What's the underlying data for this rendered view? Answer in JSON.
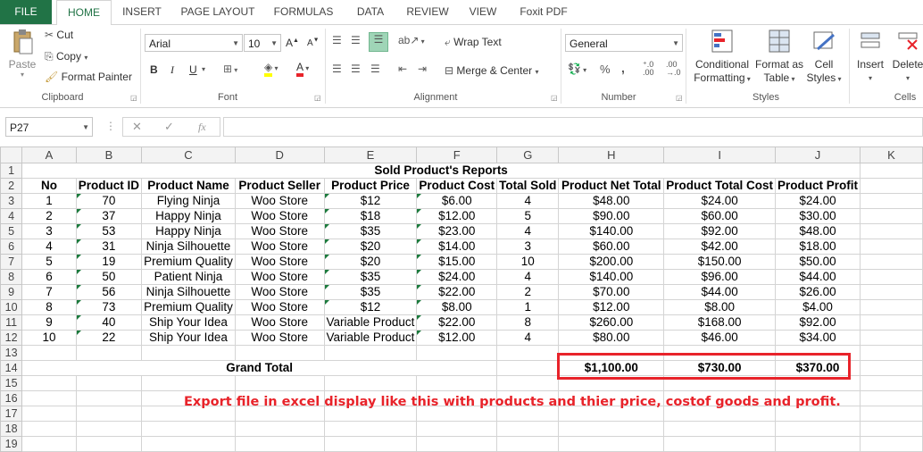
{
  "ribbon_tabs": [
    "FILE",
    "HOME",
    "INSERT",
    "PAGE LAYOUT",
    "FORMULAS",
    "DATA",
    "REVIEW",
    "VIEW",
    "Foxit PDF"
  ],
  "active_tab": "HOME",
  "colors": {
    "excel_green": "#217346",
    "annotation_red": "#e8232a",
    "header_gray": "#f3f3f3"
  },
  "clipboard": {
    "paste": "Paste",
    "cut": "Cut",
    "copy": "Copy",
    "format_painter": "Format Painter",
    "label": "Clipboard"
  },
  "font": {
    "name": "Arial",
    "size": "10",
    "label": "Font",
    "bold": "B",
    "italic": "I",
    "underline": "U"
  },
  "alignment": {
    "wrap_text": "Wrap Text",
    "merge_center": "Merge & Center",
    "label": "Alignment"
  },
  "number": {
    "format": "General",
    "percent": "%",
    "comma": ",",
    "label": "Number"
  },
  "styles": {
    "conditional": "Conditional",
    "conditional2": "Formatting",
    "format_as": "Format as",
    "format_as2": "Table",
    "cell": "Cell",
    "cell2": "Styles",
    "label": "Styles"
  },
  "cells": {
    "insert": "Insert",
    "delete": "Delete",
    "label": "Cells"
  },
  "formula_bar": {
    "name_box": "P27",
    "fx": "fx",
    "formula": ""
  },
  "columns": [
    "A",
    "B",
    "C",
    "D",
    "E",
    "F",
    "G",
    "H",
    "I",
    "J",
    "K"
  ],
  "sheet": {
    "title": "Sold Product's Reports",
    "headers": [
      "No",
      "Product ID",
      "Product Name",
      "Product Seller",
      "Product Price",
      "Product Cost",
      "Total Sold",
      "Product Net Total",
      "Product Total Cost",
      "Product Profit"
    ],
    "rows": [
      [
        "1",
        "70",
        "Flying Ninja",
        "Woo Store",
        "$12",
        "$6.00",
        "4",
        "$48.00",
        "$24.00",
        "$24.00"
      ],
      [
        "2",
        "37",
        "Happy Ninja",
        "Woo Store",
        "$18",
        "$12.00",
        "5",
        "$90.00",
        "$60.00",
        "$30.00"
      ],
      [
        "3",
        "53",
        "Happy Ninja",
        "Woo Store",
        "$35",
        "$23.00",
        "4",
        "$140.00",
        "$92.00",
        "$48.00"
      ],
      [
        "4",
        "31",
        "Ninja Silhouette",
        "Woo Store",
        "$20",
        "$14.00",
        "3",
        "$60.00",
        "$42.00",
        "$18.00"
      ],
      [
        "5",
        "19",
        "Premium Quality",
        "Woo Store",
        "$20",
        "$15.00",
        "10",
        "$200.00",
        "$150.00",
        "$50.00"
      ],
      [
        "6",
        "50",
        "Patient Ninja",
        "Woo Store",
        "$35",
        "$24.00",
        "4",
        "$140.00",
        "$96.00",
        "$44.00"
      ],
      [
        "7",
        "56",
        "Ninja Silhouette",
        "Woo Store",
        "$35",
        "$22.00",
        "2",
        "$70.00",
        "$44.00",
        "$26.00"
      ],
      [
        "8",
        "73",
        "Premium Quality",
        "Woo Store",
        "$12",
        "$8.00",
        "1",
        "$12.00",
        "$8.00",
        "$4.00"
      ],
      [
        "9",
        "40",
        "Ship Your Idea",
        "Woo Store",
        "Variable Product",
        "$22.00",
        "8",
        "$260.00",
        "$168.00",
        "$92.00"
      ],
      [
        "10",
        "22",
        "Ship Your Idea",
        "Woo Store",
        "Variable Product",
        "$12.00",
        "4",
        "$80.00",
        "$46.00",
        "$34.00"
      ]
    ],
    "grand_total_label": "Grand Total",
    "grand_total": [
      "$1,100.00",
      "$730.00",
      "$370.00"
    ],
    "row_numbers": [
      "1",
      "2",
      "3",
      "4",
      "5",
      "6",
      "7",
      "8",
      "9",
      "10",
      "11",
      "12",
      "13",
      "14",
      "15",
      "16",
      "17",
      "18",
      "19"
    ]
  },
  "annotation": "Export file in excel display like this with products and thier price, costof goods and profit."
}
